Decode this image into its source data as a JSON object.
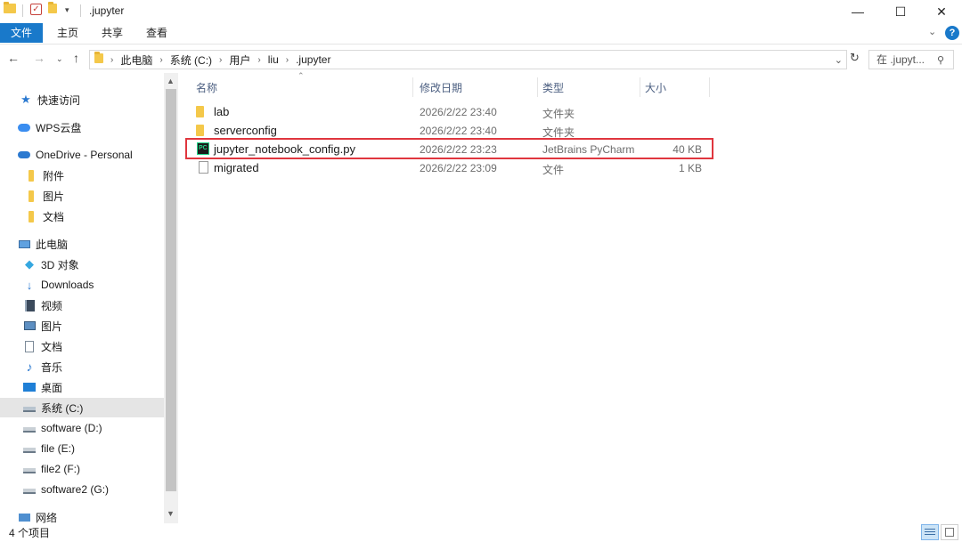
{
  "window": {
    "title": ".jupyter",
    "minimize": "—",
    "maximize": "☐",
    "close": "✕"
  },
  "ribbon": {
    "tabs": [
      "文件",
      "主页",
      "共享",
      "查看"
    ],
    "expand_icon": "chevron-down-icon",
    "help": "?"
  },
  "address": {
    "crumbs": [
      "此电脑",
      "系统 (C:)",
      "用户",
      "liu",
      ".jupyter"
    ],
    "search_placeholder": "在 .jupyt..."
  },
  "nav": {
    "items": [
      {
        "label": "快速访问",
        "icon": "star-icon"
      },
      {
        "label": "WPS云盘",
        "icon": "cloud-icon"
      },
      {
        "label": "OneDrive - Personal",
        "icon": "onedrive-icon"
      },
      {
        "label": "附件",
        "icon": "folder-icon"
      },
      {
        "label": "图片",
        "icon": "folder-icon"
      },
      {
        "label": "文档",
        "icon": "folder-icon"
      },
      {
        "label": "此电脑",
        "icon": "computer-icon"
      },
      {
        "label": "3D 对象",
        "icon": "cube-icon"
      },
      {
        "label": "Downloads",
        "icon": "download-icon"
      },
      {
        "label": "视频",
        "icon": "video-icon"
      },
      {
        "label": "图片",
        "icon": "picture-icon"
      },
      {
        "label": "文档",
        "icon": "document-icon"
      },
      {
        "label": "音乐",
        "icon": "music-icon"
      },
      {
        "label": "桌面",
        "icon": "desktop-icon"
      },
      {
        "label": "系统 (C:)",
        "icon": "drive-icon"
      },
      {
        "label": "software (D:)",
        "icon": "drive-icon"
      },
      {
        "label": "file (E:)",
        "icon": "drive-icon"
      },
      {
        "label": "file2 (F:)",
        "icon": "drive-icon"
      },
      {
        "label": "software2 (G:)",
        "icon": "drive-icon"
      },
      {
        "label": "网络",
        "icon": "network-icon"
      }
    ],
    "selected": "系统 (C:)"
  },
  "columns": {
    "name": "名称",
    "date": "修改日期",
    "type": "类型",
    "size": "大小"
  },
  "files": [
    {
      "name": "lab",
      "date": "2026/2/22 23:40",
      "type": "文件夹",
      "size": "",
      "icon": "folder-icon"
    },
    {
      "name": "serverconfig",
      "date": "2026/2/22 23:40",
      "type": "文件夹",
      "size": "",
      "icon": "folder-icon"
    },
    {
      "name": "jupyter_notebook_config.py",
      "date": "2026/2/22 23:23",
      "type": "JetBrains PyCharm",
      "size": "40 KB",
      "icon": "pycharm-icon"
    },
    {
      "name": "migrated",
      "date": "2026/2/22 23:09",
      "type": "文件",
      "size": "1 KB",
      "icon": "file-icon"
    }
  ],
  "highlight_color": "#e0363e",
  "status": {
    "item_count": "4 个项目"
  }
}
